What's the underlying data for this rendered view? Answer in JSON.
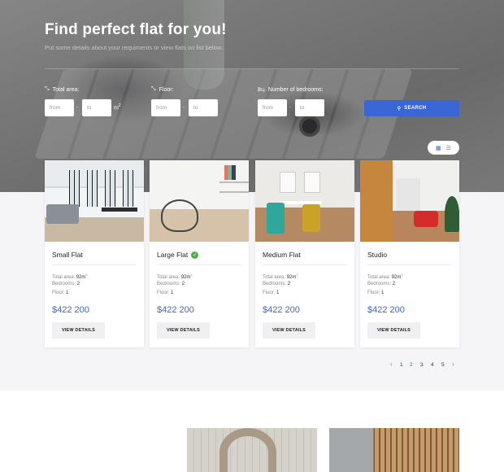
{
  "hero": {
    "title": "Find perfect flat for you!",
    "subtitle": "Put some details about your requiments or view flats on list below."
  },
  "filters": {
    "total_area": {
      "label": "Total area:",
      "icon": "resize-icon",
      "from_placeholder": "from",
      "to_placeholder": "to",
      "unit": "m",
      "unit_sup": "2"
    },
    "floor": {
      "label": "Floor:",
      "icon": "resize-icon",
      "from_placeholder": "from",
      "to_placeholder": "to"
    },
    "bedrooms": {
      "label": "Number of bedrooms:",
      "icon": "bed-icon",
      "from_placeholder": "from",
      "to_placeholder": "to"
    },
    "separator": "-",
    "search_label": "SEARCH",
    "search_icon": "search-icon"
  },
  "view_toggle": {
    "grid_icon": "grid-icon",
    "list_icon": "list-icon",
    "active": "grid"
  },
  "listings": [
    {
      "title": "Small Flat",
      "verified": false,
      "area_label": "Total area:",
      "area": "92m",
      "area_sup": "2",
      "bedrooms_label": "Bedrooms:",
      "bedrooms": "2",
      "floor_label": "Floor:",
      "floor": "1",
      "price": "$422 200",
      "button": "VIEW DETAILS"
    },
    {
      "title": "Large Flat",
      "verified": true,
      "area_label": "Total area:",
      "area": "92m",
      "area_sup": "2",
      "bedrooms_label": "Bedrooms:",
      "bedrooms": "2",
      "floor_label": "Floor:",
      "floor": "1",
      "price": "$422 200",
      "button": "VIEW DETAILS"
    },
    {
      "title": "Medium Flat",
      "verified": false,
      "area_label": "Total area:",
      "area": "92m",
      "area_sup": "2",
      "bedrooms_label": "Bedrooms:",
      "bedrooms": "2",
      "floor_label": "Floor:",
      "floor": "1",
      "price": "$422 200",
      "button": "VIEW DETAILS"
    },
    {
      "title": "Studio",
      "verified": false,
      "area_label": "Total area:",
      "area": "92m",
      "area_sup": "2",
      "bedrooms_label": "Bedrooms:",
      "bedrooms": "2",
      "floor_label": "Floor:",
      "floor": "1",
      "price": "$422 200",
      "button": "VIEW DETAILS"
    }
  ],
  "pagination": {
    "prev": "‹",
    "pages": [
      "1",
      "2",
      "3",
      "4",
      "5"
    ],
    "current": "2",
    "next": "›"
  },
  "colors": {
    "accent": "#3b66d6",
    "verified": "#4caf50"
  }
}
